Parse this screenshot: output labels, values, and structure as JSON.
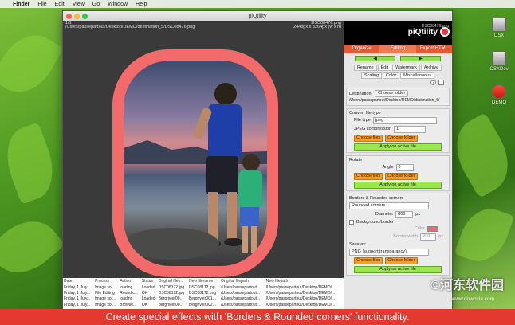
{
  "menubar": {
    "app": "Finder",
    "items": [
      "File",
      "Edit",
      "View",
      "Go",
      "Window",
      "Help"
    ]
  },
  "desktop": {
    "icons": [
      "OSX",
      "OSXDev",
      "DEMO"
    ]
  },
  "window": {
    "title": "piQtility"
  },
  "image": {
    "counter": "1/1",
    "filename": "DSC08476.png",
    "path": "/Users/passepartout/Desktop/DEMO/destination_5/DSC08476.png",
    "dimensions": "2448px x 3264px (w x h)"
  },
  "log": {
    "headers": [
      "Date",
      "Process",
      "Action",
      "Status",
      "Original filen...",
      "New filename",
      "Original filepath",
      "New filepath"
    ],
    "rows": [
      [
        "Friday, 1 July...",
        "Image sor...",
        "loading",
        "Loaded",
        "DSC08172.jpg",
        "DSC08172.jpg",
        "/Users/passepartout...",
        "/Users/passepartout/Desktop/DEMO/..."
      ],
      [
        "Friday, 1 July...",
        "File Editing",
        "Round c...",
        "OK",
        "DSC08172.jpg",
        "DSC08172.png",
        "/Users/passepartout...",
        "/Users/passepartout/Desktop/DEMO/..."
      ],
      [
        "Friday, 1 July...",
        "Image sor...",
        "loading",
        "Loaded",
        "Bergrivier00...",
        "Bergrivier001...",
        "/Users/passepartout...",
        "/Users/passepartout/Desktop/DEMO/..."
      ],
      [
        "Friday, 1 July...",
        "Image sor...",
        "Browse...",
        "OK",
        "Bergrivier00...",
        "Bergrivier002...",
        "/Users/passepartout...",
        "/Users/passepartout/Desktop/DEMO/..."
      ]
    ]
  },
  "panel": {
    "logo": "piQtility",
    "logo_sub": "DSC08476.png",
    "tabs": [
      "Organize",
      "Editing",
      "Export HTML"
    ],
    "arrows": [
      "◀",
      "▶"
    ],
    "subtabs1": [
      "Rename",
      "Edit",
      "Watermark",
      "Archive"
    ],
    "subtabs2": [
      "Scaling",
      "Color",
      "Miscellaneous"
    ],
    "destination": {
      "label": "Destination:",
      "button": "Choose folder",
      "path": "/Users/passepartout/Desktop/DEMO/destination_6/"
    },
    "convert": {
      "heading": "Convert file type",
      "filetype_label": "File type",
      "filetype_value": "jpeg",
      "jpeg_label": "JPEG compression",
      "jpeg_value": "1",
      "choose_files": "Choose files",
      "choose_folder": "Choose folder",
      "apply": "Apply on active file"
    },
    "rotate": {
      "heading": "Rotate",
      "angle_label": "Angle",
      "angle_value": "0",
      "choose_files": "Choose files",
      "choose_folder": "Choose folder",
      "apply": "Apply on active file"
    },
    "borders": {
      "heading": "Borders & Rounded corners",
      "mode": "Rounded corners",
      "diameter_label": "Diameter",
      "diameter_value": "800",
      "unit": "px",
      "background_label": "Background/border",
      "color_label": "Color",
      "border_width_label": "Border width",
      "border_width_value": "200",
      "swatch": "#f26a6a"
    },
    "save": {
      "label": "Save as:",
      "value": "PNG (support transparancy)",
      "choose_files": "Choose files",
      "choose_folder": "Choose folder",
      "apply": "Apply on active file"
    }
  },
  "caption": "Create special effects with 'Borders & Rounded corners' functionality.",
  "watermark": {
    "main": "©河东软件园",
    "url": "www.downxia.com"
  }
}
